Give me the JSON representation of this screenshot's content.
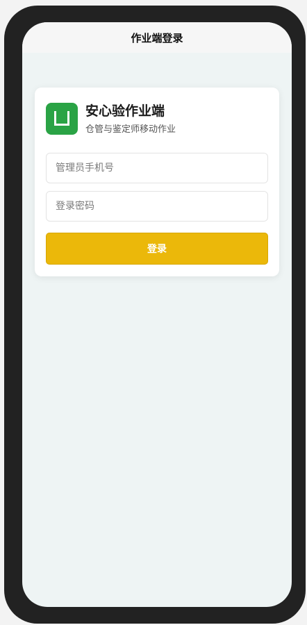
{
  "header": {
    "title": "作业端登录"
  },
  "brand": {
    "name": "安心验作业端",
    "subtitle": "仓管与鉴定师移动作业",
    "logo_icon": "app-logo-icon",
    "logo_color": "#2aa345"
  },
  "form": {
    "phone_placeholder": "管理员手机号",
    "phone_value": "",
    "password_placeholder": "登录密码",
    "password_value": "",
    "submit_label": "登录",
    "submit_color": "#ebb80a"
  }
}
